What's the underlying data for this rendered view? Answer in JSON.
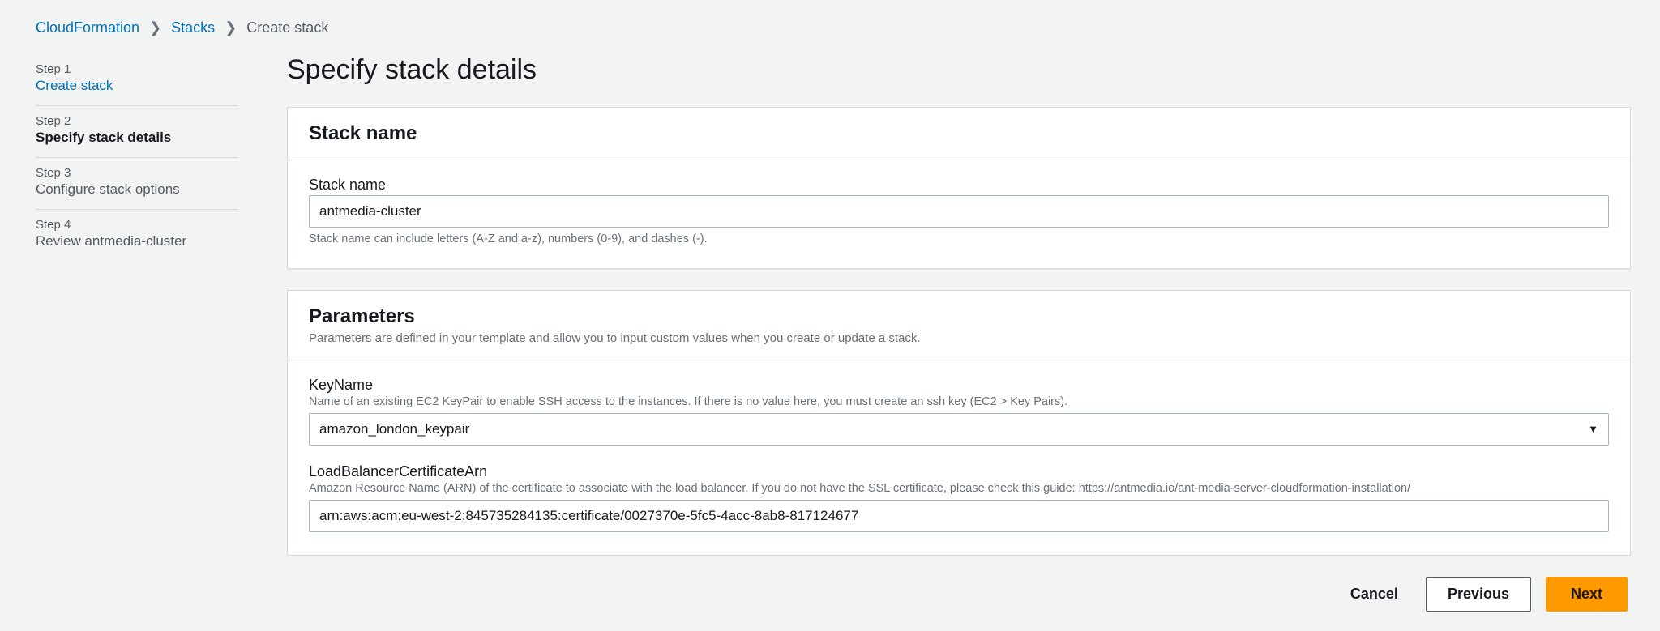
{
  "breadcrumbs": {
    "items": [
      {
        "label": "CloudFormation",
        "link": true
      },
      {
        "label": "Stacks",
        "link": true
      },
      {
        "label": "Create stack",
        "link": false
      }
    ]
  },
  "sidebar": {
    "steps": [
      {
        "num": "Step 1",
        "title": "Create stack",
        "state": "done-link"
      },
      {
        "num": "Step 2",
        "title": "Specify stack details",
        "state": "current"
      },
      {
        "num": "Step 3",
        "title": "Configure stack options",
        "state": "upcoming"
      },
      {
        "num": "Step 4",
        "title": "Review antmedia-cluster",
        "state": "upcoming"
      }
    ]
  },
  "page": {
    "title": "Specify stack details"
  },
  "stack_name_panel": {
    "heading": "Stack name",
    "field_label": "Stack name",
    "value": "antmedia-cluster",
    "hint_below": "Stack name can include letters (A-Z and a-z), numbers (0-9), and dashes (-)."
  },
  "parameters_panel": {
    "heading": "Parameters",
    "description": "Parameters are defined in your template and allow you to input custom values when you create or update a stack.",
    "key_name": {
      "label": "KeyName",
      "help": "Name of an existing EC2 KeyPair to enable SSH access to the instances. If there is no value here, you must create an ssh key (EC2 > Key Pairs).",
      "value": "amazon_london_keypair"
    },
    "lb_cert_arn": {
      "label": "LoadBalancerCertificateArn",
      "help": "Amazon Resource Name (ARN) of the certificate to associate with the load balancer. If you do not have the SSL certificate, please check this guide: https://antmedia.io/ant-media-server-cloudformation-installation/",
      "value": "arn:aws:acm:eu-west-2:845735284135:certificate/0027370e-5fc5-4acc-8ab8-817124677"
    }
  },
  "footer": {
    "cancel": "Cancel",
    "previous": "Previous",
    "next": "Next"
  }
}
